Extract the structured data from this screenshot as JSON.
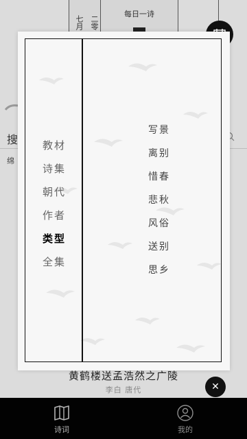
{
  "background": {
    "date_chars": [
      "七月",
      "二零"
    ],
    "daily_poem_title": "每日一诗",
    "search_label": "搜",
    "small_label": "绵"
  },
  "poem": {
    "title": "黄鹤楼送孟浩然之广陵",
    "meta": "李白 唐代"
  },
  "modal": {
    "categories": [
      {
        "label": "教材",
        "active": false
      },
      {
        "label": "诗集",
        "active": false
      },
      {
        "label": "朝代",
        "active": false
      },
      {
        "label": "作者",
        "active": false
      },
      {
        "label": "类型",
        "active": true
      },
      {
        "label": "全集",
        "active": false
      }
    ],
    "subcategories": [
      "写景",
      "离别",
      "惜春",
      "悲秋",
      "风俗",
      "送别",
      "思乡"
    ]
  },
  "close_label": "✕",
  "tabbar": {
    "tabs": [
      {
        "label": "诗词",
        "icon": "book-icon",
        "active": true
      },
      {
        "label": "我的",
        "icon": "user-icon",
        "active": false
      }
    ]
  },
  "colors": {
    "tabbar_bg": "#020202",
    "modal_bg": "#f7f7f7",
    "active_text": "#000000",
    "inactive_text": "#666666"
  }
}
